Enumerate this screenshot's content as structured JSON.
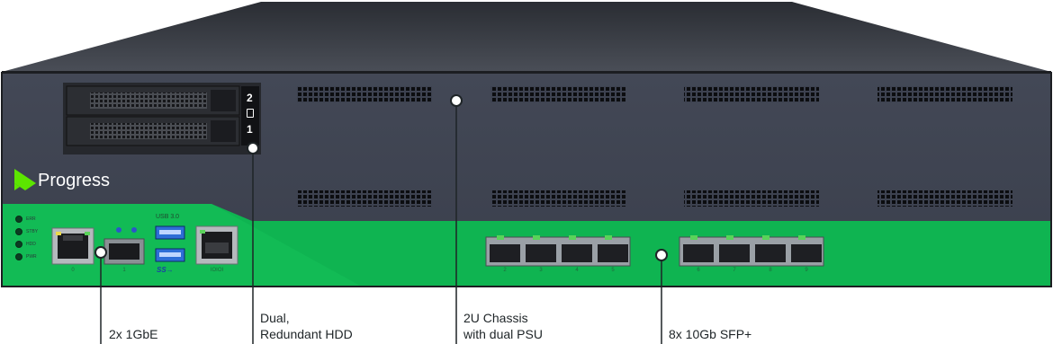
{
  "brand": {
    "name": "Progress",
    "logo_color": "#5ce500",
    "panel_color": "#3a3f4d",
    "accent_green": "#0fb451"
  },
  "front_panel": {
    "drive_bay_numbers": [
      "2",
      "1"
    ],
    "led_labels": [
      "ERR",
      "STBY",
      "HDD",
      "PWR"
    ],
    "usb_label": "USB 3.0",
    "ss_label": "SS→",
    "console_label": "IOIOI",
    "rj45_port_numbers": [
      "0",
      "1"
    ],
    "sfp_port_numbers": [
      "2",
      "3",
      "4",
      "5",
      "6",
      "7",
      "8",
      "9"
    ]
  },
  "callouts": [
    {
      "line1": "2x 1GbE",
      "line2": ""
    },
    {
      "line1": "Dual,",
      "line2": "Redundant HDD"
    },
    {
      "line1": "2U Chassis",
      "line2": "with dual PSU"
    },
    {
      "line1": "8x 10Gb SFP+",
      "line2": ""
    }
  ]
}
